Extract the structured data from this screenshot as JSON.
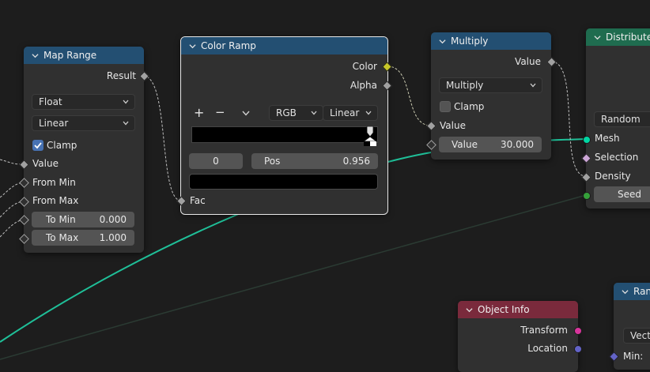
{
  "colors": {
    "background": "#1d1d1d",
    "node_body": "#303030",
    "header_blue": "#234f72",
    "header_green": "#1f6c4f",
    "header_red": "#7a2a3c",
    "geometry_socket": "#00d6a3",
    "color_socket": "#c7c729",
    "float_socket": "#a1a1a1",
    "int_socket": "#35a03a",
    "selection_socket": "#cca6d6",
    "matrix_socket": "#d8359c",
    "vector_socket": "#6363c7",
    "checkbox_on": "#4772b3"
  },
  "map_range": {
    "title": "Map Range",
    "result_label": "Result",
    "data_type": "Float",
    "interpolation": "Linear",
    "clamp_label": "Clamp",
    "clamp_checked": true,
    "inputs": [
      "Value",
      "From Min",
      "From Max"
    ],
    "to_min_label": "To Min",
    "to_min_value": "0.000",
    "to_max_label": "To Max",
    "to_max_value": "1.000"
  },
  "color_ramp": {
    "title": "Color Ramp",
    "color_label": "Color",
    "alpha_label": "Alpha",
    "add_symbol": "+",
    "remove_symbol": "−",
    "color_mode": "RGB",
    "interpolation": "Linear",
    "stop_index": "0",
    "pos_label": "Pos",
    "pos_value": "0.956",
    "fac_label": "Fac"
  },
  "multiply": {
    "title": "Multiply",
    "output_label": "Value",
    "operation": "Multiply",
    "clamp_label": "Clamp",
    "clamp_checked": false,
    "input_label": "Value",
    "value_label": "Value",
    "value": "30.000"
  },
  "distribute": {
    "title": "Distribute",
    "mode": "Random",
    "inputs": [
      "Mesh",
      "Selection",
      "Density"
    ],
    "seed_label": "Seed"
  },
  "object_info": {
    "title": "Object Info",
    "outputs": [
      "Transform",
      "Location"
    ]
  },
  "random_node": {
    "title": "Ran",
    "type_label": "Vect",
    "min_label": "Min:"
  }
}
